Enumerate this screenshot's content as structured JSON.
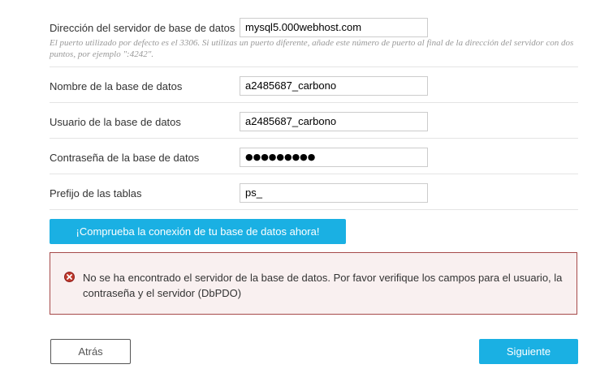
{
  "form": {
    "server": {
      "label": "Dirección del servidor de base de datos",
      "value": "mysql5.000webhost.com",
      "hint": "El puerto utilizado por defecto es el 3306. Si utilizas un puerto diferente, añade este número de puerto al final de la dirección del servidor con dos puntos, por ejemplo \":4242\"."
    },
    "db_name": {
      "label": "Nombre de la base de datos",
      "value": "a2485687_carbono"
    },
    "db_user": {
      "label": "Usuario de la base de datos",
      "value": "a2485687_carbono"
    },
    "db_password": {
      "label": "Contraseña de la base de datos",
      "value": "●●●●●●●●●"
    },
    "table_prefix": {
      "label": "Prefijo de las tablas",
      "value": "ps_"
    }
  },
  "check_button": {
    "label": "¡Comprueba la conexión de tu base de datos ahora!"
  },
  "error": {
    "icon": "error-x-icon",
    "message": "No se ha encontrado el servidor de la base de datos. Por favor verifique los campos para el usuario, la contraseña y el servidor (DbPDO)"
  },
  "nav": {
    "back_label": "Atrás",
    "next_label": "Siguiente"
  },
  "colors": {
    "accent": "#1ab0e3",
    "error_border": "#a64a4a",
    "error_bg": "#f9f0f0",
    "error_icon": "#c0392b"
  }
}
